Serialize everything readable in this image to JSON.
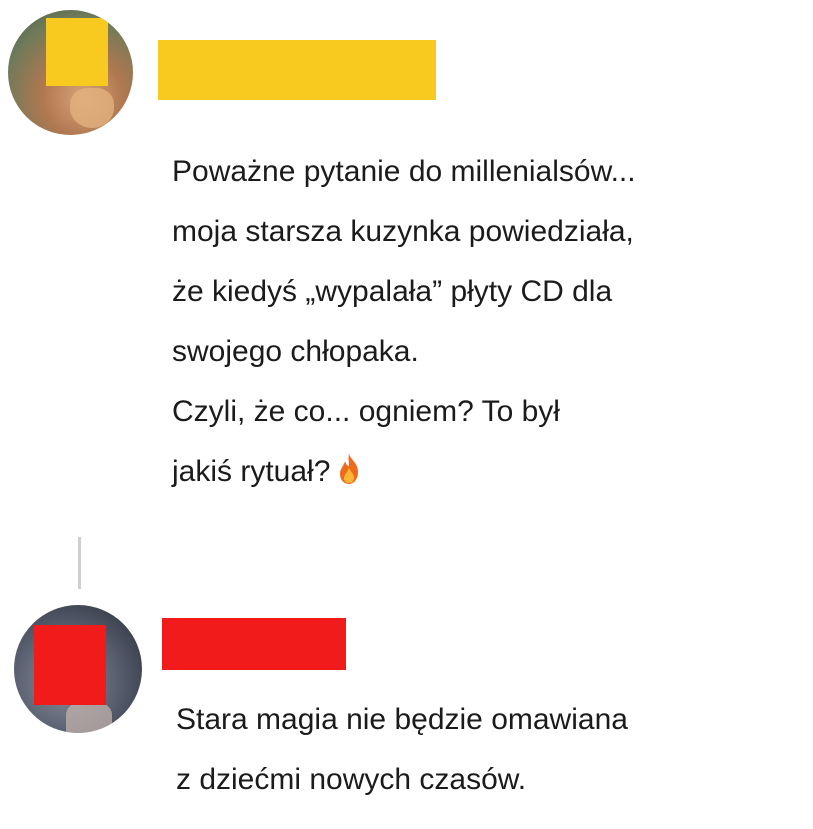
{
  "post": {
    "lines": [
      "Poważne pytanie do millenialsów...",
      "moja starsza kuzynka powiedziała,",
      "że kiedyś „wypalała” płyty CD dla",
      "swojego chłopaka.",
      "Czyli, że co... ogniem? To był",
      "jakiś rytuał?"
    ],
    "emoji_icon": "fire-icon"
  },
  "reply": {
    "lines": [
      "Stara magia nie będzie omawiana",
      "z dziećmi nowych czasów."
    ]
  },
  "colors": {
    "poster_name_censor": "#f8c91f",
    "replier_name_censor": "#f21b1b",
    "thread_line": "#cfcfcf"
  }
}
